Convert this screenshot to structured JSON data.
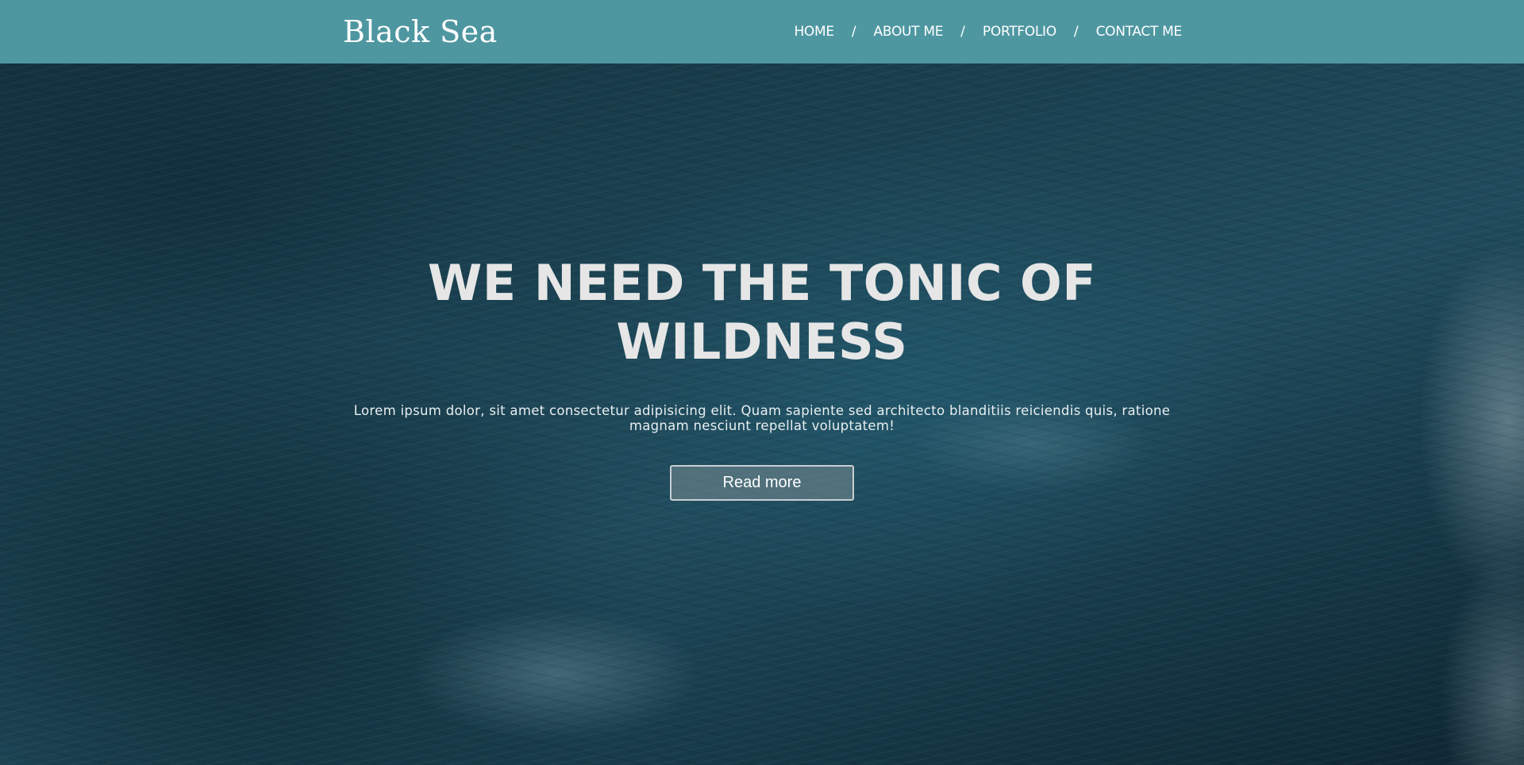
{
  "header": {
    "logo": "Black Sea",
    "nav": {
      "items": [
        "HOME",
        "ABOUT ME",
        "PORTFOLIO",
        "CONTACT ME"
      ],
      "separator": "/"
    }
  },
  "hero": {
    "headline": "WE NEED THE TONIC OF WILDNESS",
    "subtext": "Lorem ipsum dolor, sit amet consectetur adipisicing elit. Quam sapiente sed architecto blanditiis reiciendis quis, ratione magnam nesciunt repellat voluptatem!",
    "button_label": "Read more"
  },
  "colors": {
    "navbar": "#4e97a1",
    "text": "#ffffff",
    "headline": "#e6e6e6"
  }
}
